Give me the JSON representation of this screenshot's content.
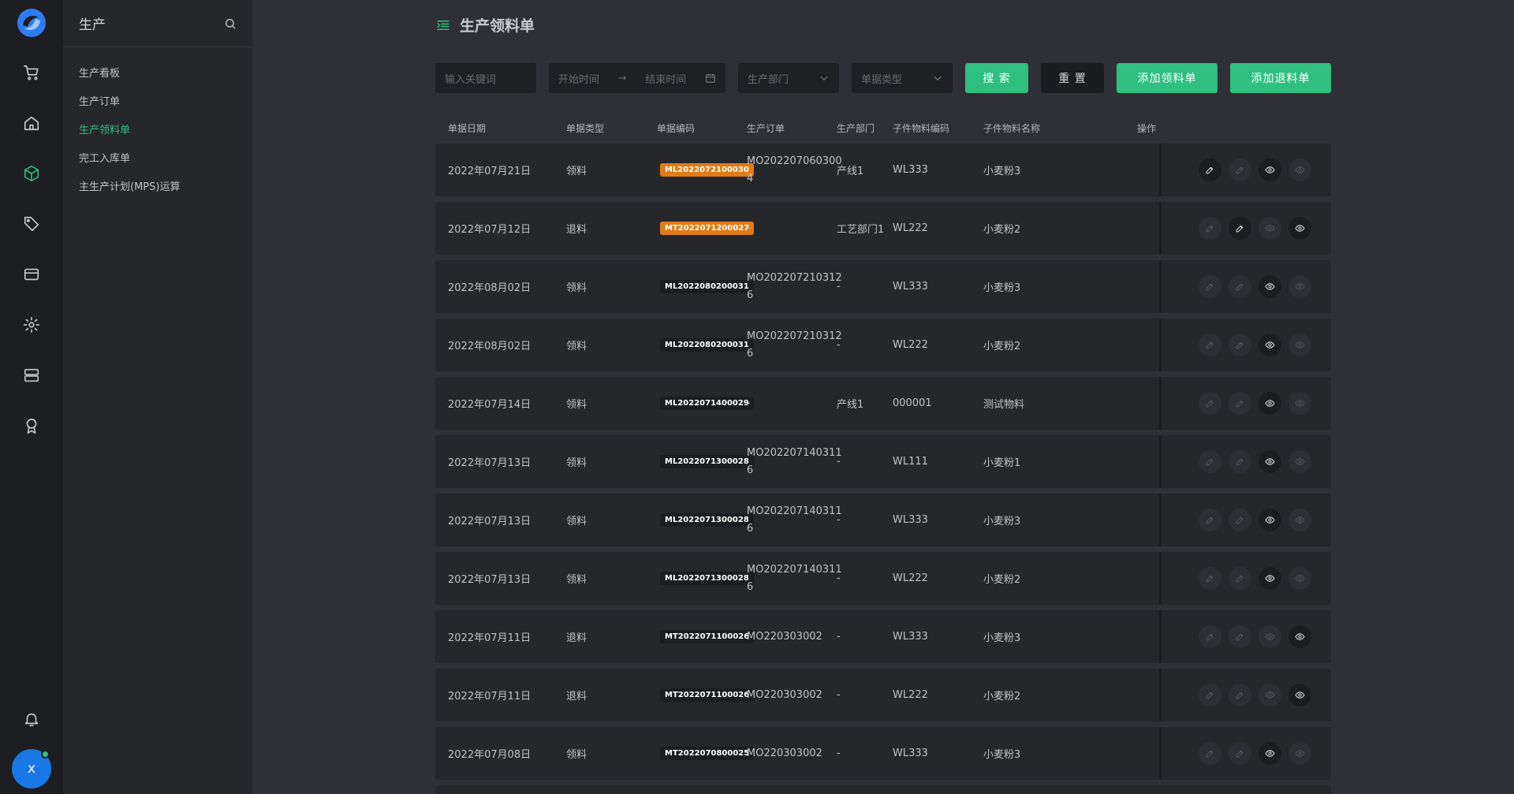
{
  "subnav": {
    "title": "生产",
    "items": [
      {
        "label": "生产看板",
        "active": false
      },
      {
        "label": "生产订单",
        "active": false
      },
      {
        "label": "生产领料单",
        "active": true
      },
      {
        "label": "完工入库单",
        "active": false
      },
      {
        "label": "主生产计划(MPS)运算",
        "active": false
      }
    ]
  },
  "user": {
    "initial": "x"
  },
  "page": {
    "title": "生产领料单"
  },
  "toolbar": {
    "keyword_placeholder": "输入关键词",
    "start_placeholder": "开始时间",
    "end_placeholder": "结束时间",
    "dept_placeholder": "生产部门",
    "type_placeholder": "单据类型",
    "search_label": "搜 索",
    "reset_label": "重 置",
    "add_pick_label": "添加领料单",
    "add_return_label": "添加退料单"
  },
  "table": {
    "columns": [
      "单据日期",
      "单据类型",
      "单据编码",
      "生产订单",
      "生产部门",
      "子件物料编码",
      "子件物料名称",
      "操作"
    ],
    "rows": [
      {
        "date": "2022年07月21日",
        "type": "领料",
        "code": "ML2022072100030",
        "code_color": "orange",
        "mo": "MO2022070603004",
        "dept": "产线1",
        "mcode": "WL333",
        "mname": "小麦粉3",
        "ops": [
          true,
          false,
          true,
          false
        ]
      },
      {
        "date": "2022年07月12日",
        "type": "退料",
        "code": "MT2022071200027",
        "code_color": "orange",
        "mo": "-",
        "dept": "工艺部门1",
        "mcode": "WL222",
        "mname": "小麦粉2",
        "ops": [
          false,
          true,
          false,
          true
        ]
      },
      {
        "date": "2022年08月02日",
        "type": "领料",
        "code": "ML2022080200031",
        "code_color": "dark",
        "mo": "MO2022072103126",
        "dept": "-",
        "mcode": "WL333",
        "mname": "小麦粉3",
        "ops": [
          false,
          false,
          true,
          false
        ]
      },
      {
        "date": "2022年08月02日",
        "type": "领料",
        "code": "ML2022080200031",
        "code_color": "dark",
        "mo": "MO2022072103126",
        "dept": "-",
        "mcode": "WL222",
        "mname": "小麦粉2",
        "ops": [
          false,
          false,
          true,
          false
        ]
      },
      {
        "date": "2022年07月14日",
        "type": "领料",
        "code": "ML2022071400029",
        "code_color": "dark",
        "mo": "-",
        "dept": "产线1",
        "mcode": "000001",
        "mname": "测试物料",
        "ops": [
          false,
          false,
          true,
          false
        ]
      },
      {
        "date": "2022年07月13日",
        "type": "领料",
        "code": "ML2022071300028",
        "code_color": "dark",
        "mo": "MO2022071403116",
        "dept": "-",
        "mcode": "WL111",
        "mname": "小麦粉1",
        "ops": [
          false,
          false,
          true,
          false
        ]
      },
      {
        "date": "2022年07月13日",
        "type": "领料",
        "code": "ML2022071300028",
        "code_color": "dark",
        "mo": "MO2022071403116",
        "dept": "-",
        "mcode": "WL333",
        "mname": "小麦粉3",
        "ops": [
          false,
          false,
          true,
          false
        ]
      },
      {
        "date": "2022年07月13日",
        "type": "领料",
        "code": "ML2022071300028",
        "code_color": "dark",
        "mo": "MO2022071403116",
        "dept": "-",
        "mcode": "WL222",
        "mname": "小麦粉2",
        "ops": [
          false,
          false,
          true,
          false
        ]
      },
      {
        "date": "2022年07月11日",
        "type": "退料",
        "code": "MT2022071100026",
        "code_color": "dark",
        "mo": "MO220303002",
        "dept": "-",
        "mcode": "WL333",
        "mname": "小麦粉3",
        "ops": [
          false,
          false,
          false,
          true
        ]
      },
      {
        "date": "2022年07月11日",
        "type": "退料",
        "code": "MT2022071100026",
        "code_color": "dark",
        "mo": "MO220303002",
        "dept": "-",
        "mcode": "WL222",
        "mname": "小麦粉2",
        "ops": [
          false,
          false,
          false,
          true
        ]
      },
      {
        "date": "2022年07月08日",
        "type": "领料",
        "code": "MT2022070800025",
        "code_color": "dark",
        "mo": "MO220303002",
        "dept": "-",
        "mcode": "WL333",
        "mname": "小麦粉3",
        "ops": [
          false,
          false,
          true,
          false
        ]
      }
    ]
  },
  "icons": {
    "rail": [
      "cart-icon",
      "home-icon",
      "cube-icon",
      "tag-icon",
      "card-icon",
      "gear-icon",
      "server-icon",
      "award-icon",
      "bell-icon"
    ],
    "ops": [
      "edit-icon",
      "edit-icon",
      "eye-icon",
      "eye-icon"
    ]
  },
  "colors": {
    "accent": "#2fbf7f",
    "badge_orange": "#e07b16",
    "avatar": "#1778e6"
  }
}
